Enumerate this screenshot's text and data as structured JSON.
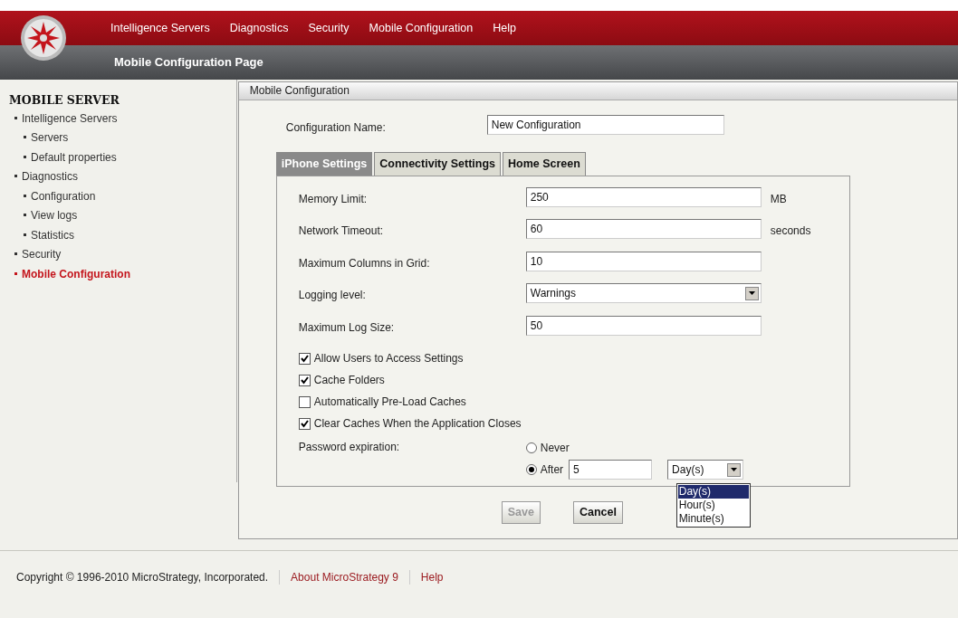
{
  "nav": {
    "items": [
      {
        "label": "Intelligence Servers"
      },
      {
        "label": "Diagnostics"
      },
      {
        "label": "Security"
      },
      {
        "label": "Mobile Configuration"
      },
      {
        "label": "Help"
      }
    ]
  },
  "page_title": "Mobile Configuration Page",
  "sidebar": {
    "heading": "MOBILE SERVER",
    "items": [
      {
        "label": "Intelligence Servers",
        "selected": false,
        "children": [
          {
            "label": "Servers",
            "selected": false
          },
          {
            "label": "Default properties",
            "selected": false
          }
        ]
      },
      {
        "label": "Diagnostics",
        "selected": false,
        "children": [
          {
            "label": "Configuration",
            "selected": false
          },
          {
            "label": "View logs",
            "selected": false
          },
          {
            "label": "Statistics",
            "selected": false
          }
        ]
      },
      {
        "label": "Security",
        "selected": false
      },
      {
        "label": "Mobile Configuration",
        "selected": true
      }
    ]
  },
  "panel": {
    "title": "Mobile Configuration",
    "config_name": {
      "label": "Configuration Name:",
      "value": "New Configuration"
    },
    "tabs": [
      {
        "label": "iPhone Settings",
        "selected": true
      },
      {
        "label": "Connectivity Settings",
        "selected": false
      },
      {
        "label": "Home Screen",
        "selected": false
      }
    ],
    "fields": [
      {
        "kind": "text",
        "label": "Memory Limit:",
        "value": "250",
        "unit": "MB"
      },
      {
        "kind": "text",
        "label": "Network Timeout:",
        "value": "60",
        "unit": "seconds"
      },
      {
        "kind": "text",
        "label": "Maximum Columns in Grid:",
        "value": "10"
      },
      {
        "kind": "select",
        "label": "Logging level:",
        "value": "Warnings"
      },
      {
        "kind": "text",
        "label": "Maximum Log Size:",
        "value": "50"
      }
    ],
    "checkboxes": [
      {
        "label": "Allow Users to Access Settings",
        "checked": true
      },
      {
        "label": "Cache Folders",
        "checked": true
      },
      {
        "label": "Automatically Pre-Load Caches",
        "checked": false
      },
      {
        "label": "Clear Caches When the Application Closes",
        "checked": true
      }
    ],
    "password_expiration": {
      "label": "Password expiration:",
      "options": [
        {
          "label": "Never",
          "selected": false
        },
        {
          "label": "After",
          "selected": true
        }
      ],
      "after_value": "5",
      "unit_value": "Day(s)",
      "unit_options": [
        {
          "label": "Day(s)",
          "selected": true
        },
        {
          "label": "Hour(s)",
          "selected": false
        },
        {
          "label": "Minute(s)",
          "selected": false
        }
      ]
    },
    "buttons": [
      {
        "label": "Save",
        "disabled": true
      },
      {
        "label": "Cancel",
        "disabled": false
      }
    ]
  },
  "footer": {
    "copyright": "Copyright © 1996-2010 MicroStrategy, Incorporated.",
    "links": [
      "About MicroStrategy 9",
      "Help"
    ]
  }
}
